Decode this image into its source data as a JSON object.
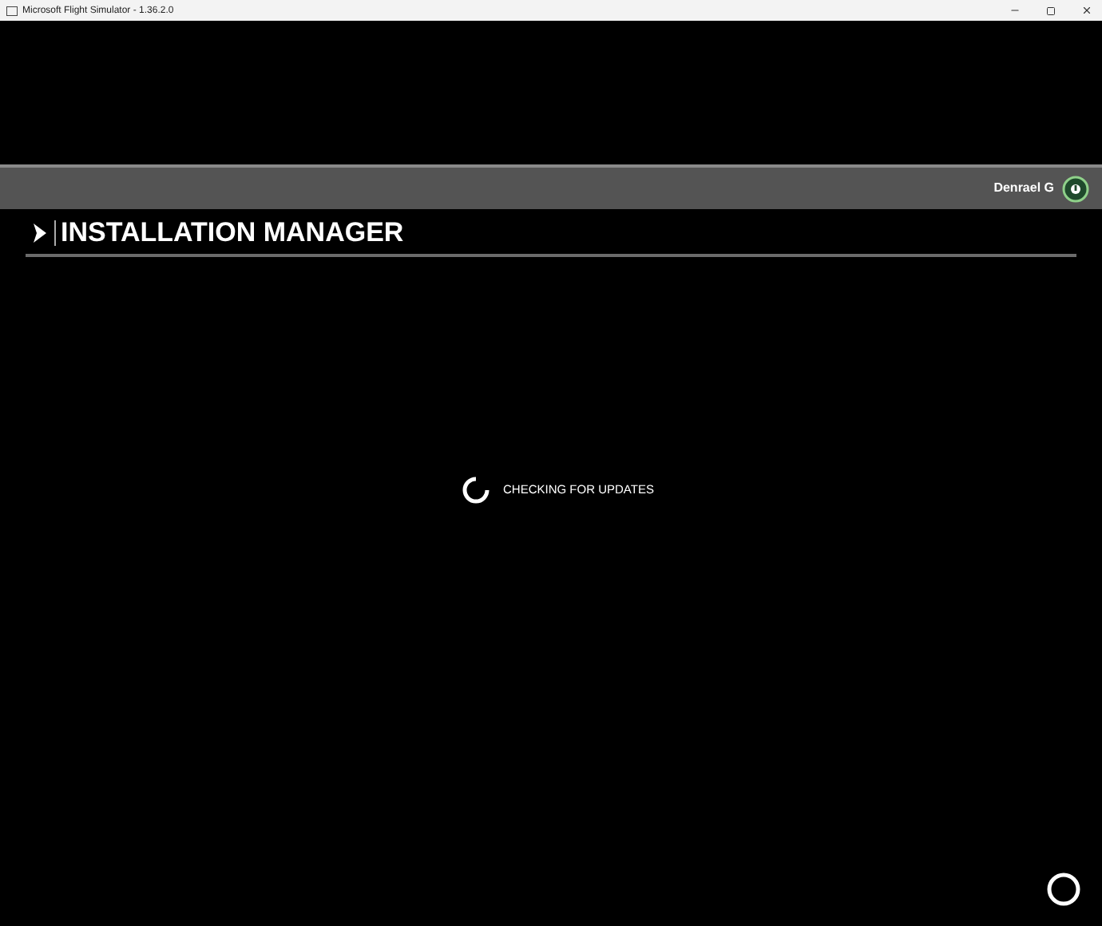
{
  "window": {
    "title": "Microsoft Flight Simulator - 1.36.2.0"
  },
  "user": {
    "name": "Denrael G"
  },
  "page": {
    "title": "INSTALLATION MANAGER"
  },
  "status": {
    "text": "CHECKING FOR UPDATES"
  }
}
